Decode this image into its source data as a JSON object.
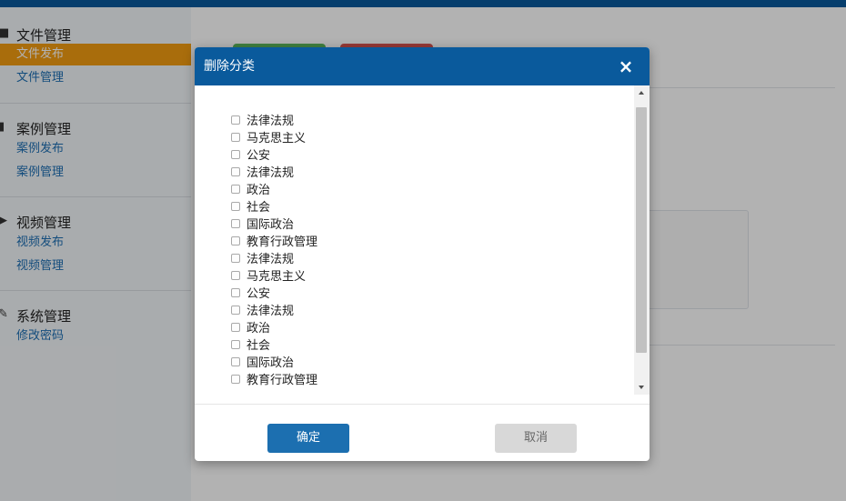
{
  "sidebar": {
    "groups": [
      {
        "icon": "folder-icon",
        "title": "文件管理",
        "items": [
          "文件发布",
          "文件管理"
        ]
      },
      {
        "icon": "chart-icon",
        "title": "案例管理",
        "items": [
          "案例发布",
          "案例管理"
        ]
      },
      {
        "icon": "video-icon",
        "title": "视频管理",
        "items": [
          "视频发布",
          "视频管理"
        ]
      },
      {
        "icon": "wrench-icon",
        "title": "系统管理",
        "items": [
          "修改密码"
        ]
      }
    ],
    "active_item": "文件发布"
  },
  "modal": {
    "title": "删除分类",
    "close_symbol": "×",
    "categories": [
      "法律法规",
      "马克思主义",
      "公安",
      "法律法规",
      "政治",
      "社会",
      "国际政治",
      "教育行政管理",
      "法律法规",
      "马克思主义",
      "公安",
      "法律法规",
      "政治",
      "社会",
      "国际政治",
      "教育行政管理"
    ],
    "confirm_label": "确定",
    "cancel_label": "取消"
  },
  "colors": {
    "header": "#0a5a9c",
    "active_nav": "#f39c12",
    "confirm": "#1c6fb0"
  }
}
